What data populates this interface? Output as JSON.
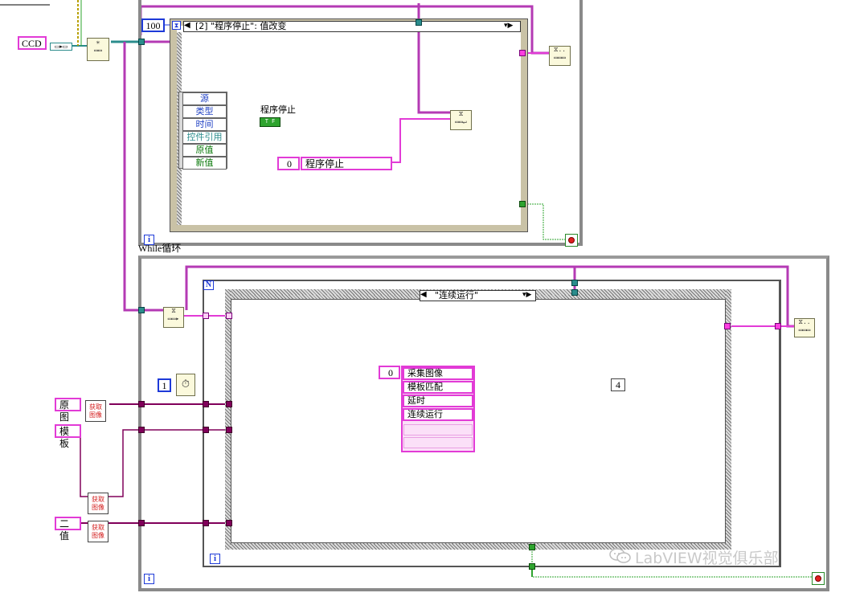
{
  "top_loop": {
    "timeout_constant": "100",
    "event_case_selector": "[2] \"程序停止\": 值改变",
    "event_data_node": [
      "源",
      "类型",
      "时间",
      "控件引用",
      "原值",
      "新值"
    ],
    "control_label": "程序停止",
    "bool_constant": "T F",
    "enqueue_index": "0",
    "enqueue_string": "程序停止",
    "loop_label": "While循环",
    "iteration_terminal": "i"
  },
  "left_controls": {
    "ccd": "CCD",
    "original": "原图",
    "template": "模板",
    "binary": "二值",
    "get_image": "获取\n图像"
  },
  "bottom_loop": {
    "wait_constant": "1",
    "case_selector": "\"连续运行\"",
    "array_index": "0",
    "array_items": [
      "采集图像",
      "模板匹配",
      "延时",
      "连续运行"
    ],
    "index_constant": "4",
    "for_loop_terminal": "N",
    "iteration_terminal": "i"
  },
  "watermark": "LabVIEW视觉俱乐部",
  "colors": {
    "string_wire": "#e23bd6",
    "cluster_wire": "#80005a",
    "bool_wire": "#2fa42f",
    "ref_wire": "#2b8c8c",
    "numeric_wire": "#1e3ad8"
  }
}
